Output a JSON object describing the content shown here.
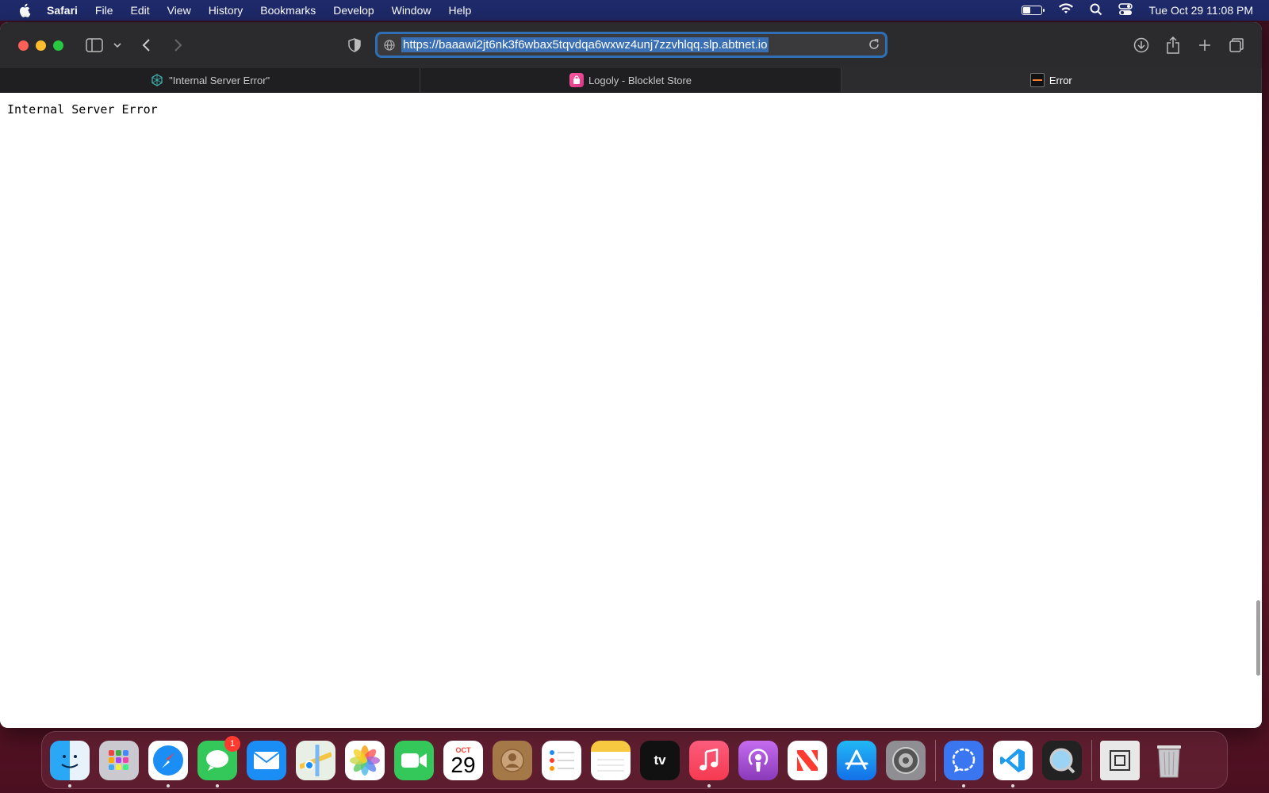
{
  "menubar": {
    "app_name": "Safari",
    "items": [
      "File",
      "Edit",
      "View",
      "History",
      "Bookmarks",
      "Develop",
      "Window",
      "Help"
    ],
    "clock": "Tue Oct 29  11:08 PM",
    "battery_level": 0.35
  },
  "toolbar": {
    "url": "https://baaawi2jt6nk3f6wbax5tqvdqa6wxwz4unj7zzvhlqq.slp.abtnet.io"
  },
  "tabs": [
    {
      "label": "\"Internal Server Error\"",
      "icon": "hexagon-logo-icon"
    },
    {
      "label": "Logoly - Blocklet Store",
      "icon": "store-bag-icon"
    },
    {
      "label": "Error",
      "icon": "dark-site-icon"
    }
  ],
  "page": {
    "error_text": "Internal Server Error"
  },
  "dock": {
    "messages_badge": "1",
    "calendar_month": "OCT",
    "calendar_day": "29"
  },
  "colors": {
    "menubar": "#1e2a6a",
    "accent": "#2f6fb5",
    "close": "#fe5f57",
    "minimize": "#febc2e",
    "maximize": "#28c840"
  }
}
